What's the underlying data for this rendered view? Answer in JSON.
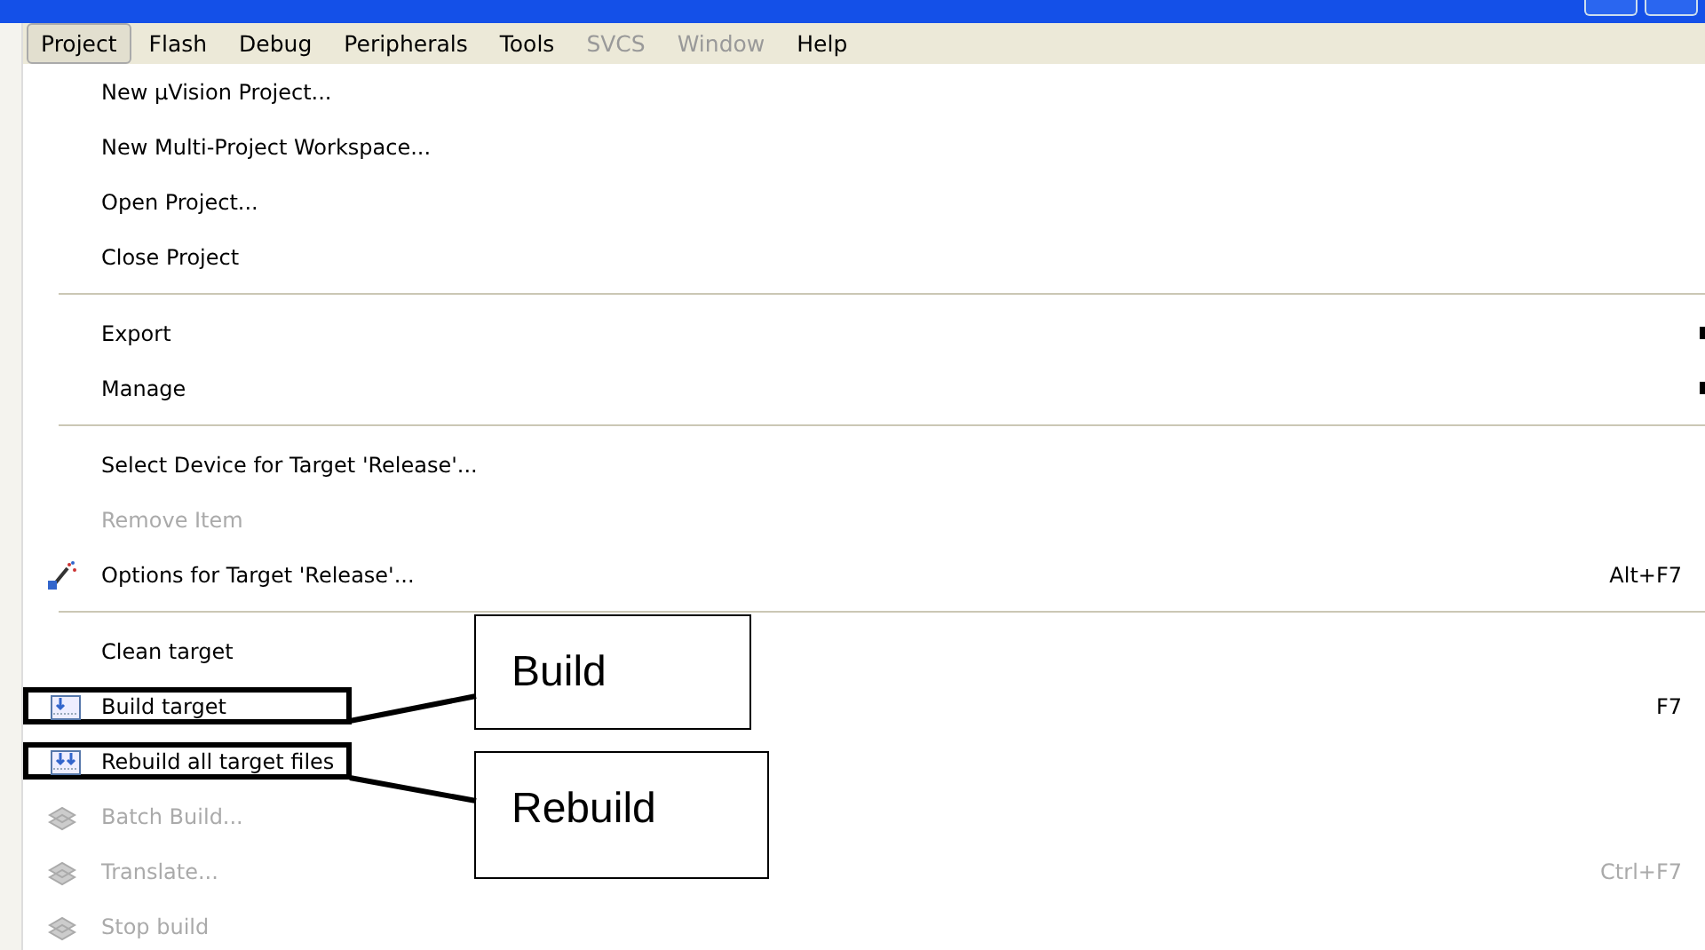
{
  "menubar": [
    {
      "label": "Project",
      "selected": true,
      "disabled": false
    },
    {
      "label": "Flash",
      "selected": false,
      "disabled": false
    },
    {
      "label": "Debug",
      "selected": false,
      "disabled": false
    },
    {
      "label": "Peripherals",
      "selected": false,
      "disabled": false
    },
    {
      "label": "Tools",
      "selected": false,
      "disabled": false
    },
    {
      "label": "SVCS",
      "selected": false,
      "disabled": true
    },
    {
      "label": "Window",
      "selected": false,
      "disabled": true
    },
    {
      "label": "Help",
      "selected": false,
      "disabled": false
    }
  ],
  "menu": [
    {
      "kind": "item",
      "label": "New µVision Project...",
      "disabled": false
    },
    {
      "kind": "item",
      "label": "New Multi-Project Workspace...",
      "disabled": false
    },
    {
      "kind": "item",
      "label": "Open Project...",
      "disabled": false
    },
    {
      "kind": "item",
      "label": "Close Project",
      "disabled": false
    },
    {
      "kind": "separator"
    },
    {
      "kind": "item",
      "label": "Export",
      "disabled": false,
      "submenu": true
    },
    {
      "kind": "item",
      "label": "Manage",
      "disabled": false,
      "submenu": true
    },
    {
      "kind": "separator"
    },
    {
      "kind": "item",
      "label": "Select Device for Target 'Release'...",
      "disabled": false
    },
    {
      "kind": "item",
      "label": "Remove Item",
      "disabled": true
    },
    {
      "kind": "item",
      "label": "Options for Target 'Release'...",
      "disabled": false,
      "shortcut": "Alt+F7",
      "has_icon": true
    },
    {
      "kind": "separator"
    },
    {
      "kind": "item",
      "label": "Clean target",
      "disabled": false
    },
    {
      "kind": "item",
      "label": "Build target",
      "disabled": false,
      "shortcut": "F7",
      "has_icon": true,
      "highlighted": true
    },
    {
      "kind": "item",
      "label": "Rebuild all target files",
      "disabled": false,
      "has_icon": true,
      "highlighted": true
    },
    {
      "kind": "item",
      "label": "Batch Build...",
      "disabled": true,
      "has_icon": true
    },
    {
      "kind": "item",
      "label": "Translate...",
      "disabled": true,
      "shortcut": "Ctrl+F7",
      "has_icon": true
    },
    {
      "kind": "item",
      "label": "Stop build",
      "disabled": true,
      "has_icon": true
    }
  ],
  "callouts": [
    {
      "label": "Build"
    },
    {
      "label": "Rebuild"
    }
  ]
}
